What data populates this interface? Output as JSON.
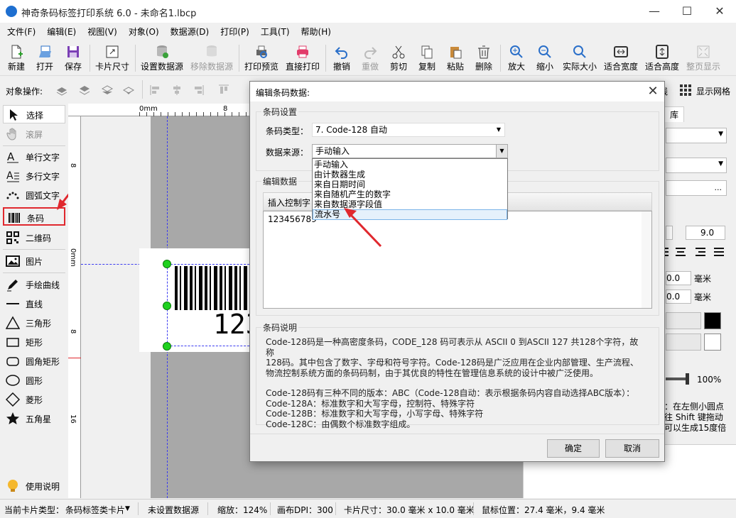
{
  "window": {
    "title": "神奇条码标签打印系统 6.0 - 未命名1.lbcp",
    "controls": [
      "—",
      "☐",
      "✕"
    ]
  },
  "menu": [
    "文件(F)",
    "编辑(E)",
    "视图(V)",
    "对象(O)",
    "数据源(D)",
    "打印(P)",
    "工具(T)",
    "帮助(H)"
  ],
  "toolbar": {
    "new": "新建",
    "open": "打开",
    "save": "保存",
    "card_size": "卡片尺寸",
    "set_datasource": "设置数据源",
    "remove_datasource": "移除数据源",
    "print_preview": "打印预览",
    "print": "直接打印",
    "undo": "撤销",
    "redo": "重做",
    "cut": "剪切",
    "copy": "复制",
    "paste": "粘贴",
    "delete": "删除",
    "zoom_in": "放大",
    "zoom_out": "缩小",
    "actual_size": "实际大小",
    "fit_width": "适合宽度",
    "fit_height": "适合高度",
    "fit_page": "整页显示"
  },
  "ops_row": {
    "label": "对象操作:",
    "right_frag": "线",
    "grid_label": "显示网格"
  },
  "tools": [
    {
      "label": "选择",
      "icon": "cursor-icon"
    },
    {
      "label": "滚屏",
      "icon": "hand-icon"
    },
    {
      "label": "单行文字",
      "icon": "text-icon"
    },
    {
      "label": "多行文字",
      "icon": "multiline-text-icon"
    },
    {
      "label": "圆弧文字",
      "icon": "arc-text-icon"
    },
    {
      "label": "条码",
      "icon": "barcode-icon"
    },
    {
      "label": "二维码",
      "icon": "qrcode-icon"
    },
    {
      "label": "图片",
      "icon": "image-icon"
    },
    {
      "label": "手绘曲线",
      "icon": "pen-icon"
    },
    {
      "label": "直线",
      "icon": "line-icon"
    },
    {
      "label": "三角形",
      "icon": "triangle-icon"
    },
    {
      "label": "矩形",
      "icon": "rectangle-icon"
    },
    {
      "label": "圆角矩形",
      "icon": "rounded-rect-icon"
    },
    {
      "label": "圆形",
      "icon": "circle-icon"
    },
    {
      "label": "菱形",
      "icon": "diamond-icon"
    },
    {
      "label": "五角星",
      "icon": "star-icon"
    },
    {
      "label": "使用说明",
      "icon": "lightbulb-icon"
    }
  ],
  "canvas": {
    "ruler_top": [
      "0mm",
      "8"
    ],
    "ruler_left": [
      "8",
      "0mm",
      "8",
      "16"
    ],
    "barcode_text": "123"
  },
  "right_panel": {
    "tab_frag": "库",
    "font_size": "9.0",
    "val1": "0.0",
    "val2": "0.0",
    "unit": "毫米",
    "percent": "100%",
    "hint_lines": [
      "：在左侧小圆点",
      "往 Shift 键拖动",
      "可以生成15度倍"
    ],
    "ellipsis": "..."
  },
  "status": {
    "card_type_label": "当前卡片类型：",
    "card_type_value": "条码标签类卡片",
    "datasource": "未设置数据源",
    "zoom": "缩放：124%",
    "dpi": "画布DPI：300",
    "card_size": "卡片尺寸：30.0 毫米 x 10.0 毫米",
    "mouse": "鼠标位置：27.4 毫米，9.4 毫米"
  },
  "dialog": {
    "title": "编辑条码数据:",
    "close": "✕",
    "group_settings": "条码设置",
    "type_label": "条码类型：",
    "type_value": "7. Code-128 自动",
    "source_label": "数据来源：",
    "source_value": "手动输入",
    "dropdown_options": [
      "手动输入",
      "由计数器生成",
      "来自日期时间",
      "来自随机产生的数字",
      "来自数据源字段值",
      "流水号"
    ],
    "group_edit": "编辑数据",
    "insert_ctrl": "插入控制字",
    "data_value": "123456789",
    "group_desc": "条码说明",
    "desc_lines": [
      "Code-128码是一种高密度条码，CODE_128 码可表示从 ASCII 0 到ASCII 127 共128个字符，故称",
      "128码。其中包含了数字、字母和符号字符。Code-128码是广泛应用在企业内部管理、生产流程、",
      "物流控制系统方面的条码码制，由于其优良的特性在管理信息系统的设计中被广泛使用。",
      "",
      "Code-128码有三种不同的版本：ABC（Code-128自动：表示根据条码内容自动选择ABC版本）：",
      "Code-128A：标准数字和大写字母，控制符、特殊字符",
      "Code-128B：标准数字和大写字母，小写字母、特殊字符",
      "Code-128C：由偶数个标准数字组成。"
    ],
    "ok": "确定",
    "cancel": "取消"
  },
  "colors": {
    "accent_red": "#e0282e",
    "handle_green": "#1fd11f",
    "guide_blue": "#3a3af0"
  }
}
